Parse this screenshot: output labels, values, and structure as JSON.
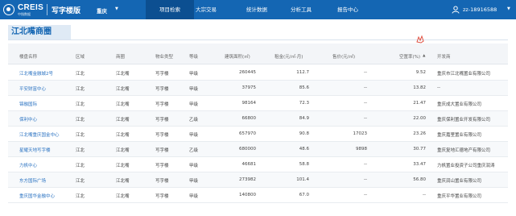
{
  "header": {
    "logo_text": "CREIS",
    "logo_sub": "中指数据",
    "product": "写字楼版",
    "city": "重庆",
    "nav": [
      "项目检索",
      "大宗交易",
      "统计数据",
      "分析工具",
      "报告中心"
    ],
    "active_nav": 0,
    "user": "zz-18916588"
  },
  "section": {
    "title": "江北嘴商圈"
  },
  "table": {
    "columns": [
      "楼盘名称",
      "区域",
      "商圈",
      "物业类型",
      "等级",
      "建筑面积(㎡)",
      "租金(元/㎡·月)",
      "售价(元/㎡)",
      "空置率(%)",
      "开发商"
    ],
    "rows": [
      [
        "江北嘴金融城2号",
        "江北",
        "江北嘴",
        "写字楼",
        "甲级",
        "260445",
        "112.7",
        "--",
        "9.52",
        "重庆市江北嘴置业有限公司"
      ],
      [
        "平安财富中心",
        "江北",
        "江北嘴",
        "写字楼",
        "甲级",
        "37975",
        "85.6",
        "--",
        "13.82",
        "--"
      ],
      [
        "锦融国际",
        "江北",
        "江北嘴",
        "写字楼",
        "甲级",
        "98164",
        "72.3",
        "--",
        "21.47",
        "重庆成大置业有限公司"
      ],
      [
        "保利中心",
        "江北",
        "江北嘴",
        "写字楼",
        "乙级",
        "66800",
        "84.9",
        "--",
        "22.00",
        "重庆保利置业开发有限公司"
      ],
      [
        "江北嘴重庆国金中心",
        "江北",
        "江北嘴",
        "写字楼",
        "甲级",
        "657970",
        "90.8",
        "17023",
        "23.26",
        "重庆嘉里置业有限公司"
      ],
      [
        "星耀天地写字楼",
        "江北",
        "江北嘴",
        "写字楼",
        "乙级",
        "680000",
        "48.6",
        "9898",
        "30.77",
        "重庆复地汇德地产有限公司"
      ],
      [
        "力帆中心",
        "江北",
        "江北嘴",
        "写字楼",
        "甲级",
        "46681",
        "58.8",
        "--",
        "33.47",
        "力帆置业投资子公司重庆润涛"
      ],
      [
        "东方国际广场",
        "江北",
        "江北嘴",
        "写字楼",
        "甲级",
        "273982",
        "101.4",
        "--",
        "56.80",
        "重庆润山置业有限公司"
      ],
      [
        "重庆国华金融中心",
        "江北",
        "江北嘴",
        "写字楼",
        "甲级",
        "140800",
        "67.0",
        "--",
        "--",
        "重庆平华置业有限公司"
      ]
    ]
  },
  "colors": {
    "nav_bg": "#1466b3",
    "nav_active": "#0c4f91",
    "link": "#2b73c2"
  }
}
